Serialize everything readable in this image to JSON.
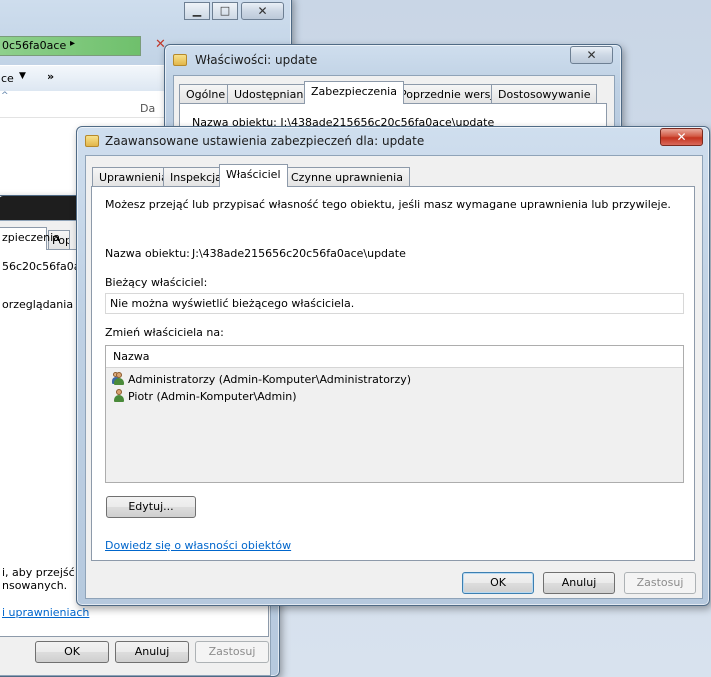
{
  "background_explorer": {
    "address_fragment": "0c56fa0ace",
    "toolbar_fragment": "ce",
    "column_fragment": "Da"
  },
  "background_props_left": {
    "tab_fragment_1": "zpieczenia",
    "tab_fragment_2": "Pop",
    "object_fragment": "56c20c56fa0a",
    "text_fragment": "orzeglądania lub",
    "bottom_text_1": "i, aby przejść do",
    "bottom_text_2": "nsowanych.",
    "link_fragment": "i uprawnieniach",
    "ok": "OK",
    "cancel": "Anuluj",
    "apply": "Zastosuj"
  },
  "props_window": {
    "title": "Właściwości: update",
    "tabs": [
      "Ogólne",
      "Udostępnianie",
      "Zabezpieczenia",
      "Poprzednie wersje",
      "Dostosowywanie"
    ],
    "active_tab": "Zabezpieczenia",
    "object_name": "Nazwa obiektu:  J:\\438ade215656c20c56fa0ace\\update",
    "close_glyph": "✕"
  },
  "advanced_window": {
    "title": "Zaawansowane ustawienia zabezpieczeń dla: update",
    "close_glyph": "✕",
    "tabs": [
      "Uprawnienia",
      "Inspekcja",
      "Właściciel",
      "Czynne uprawnienia"
    ],
    "active_tab": "Właściciel",
    "intro": "Możesz przejąć lub przypisać własność tego obiektu, jeśli masz wymagane uprawnienia lub przywileje.",
    "object_label": "Nazwa obiektu:",
    "object_value": "J:\\438ade215656c20c56fa0ace\\update",
    "current_owner_label": "Bieżący właściciel:",
    "current_owner_value": "Nie można wyświetlić bieżącego właściciela.",
    "change_owner_label": "Zmień właściciela na:",
    "list_header": "Nazwa",
    "owners": [
      {
        "name": "Administratorzy (Admin-Komputer\\Administratorzy)",
        "icon": "group-users-icon"
      },
      {
        "name": "Piotr (Admin-Komputer\\Admin)",
        "icon": "user-icon"
      }
    ],
    "edit_button": "Edytuj...",
    "help_link": "Dowiedz się o własności obiektów",
    "ok": "OK",
    "cancel": "Anuluj",
    "apply": "Zastosuj"
  }
}
